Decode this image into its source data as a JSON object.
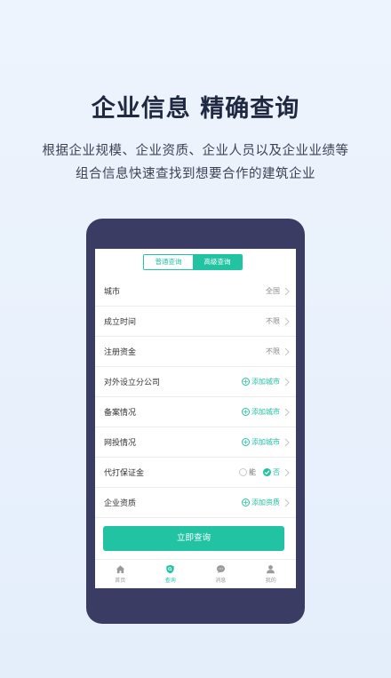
{
  "headline": "企业信息 精确查询",
  "subtitle_lines": [
    "根据企业规模、企业资质、企业人员以及企业业绩等",
    "组合信息快速查找到想要合作的建筑企业"
  ],
  "colors": {
    "accent": "#21c3a2",
    "phone_frame": "#3b3c64"
  },
  "segment": {
    "normal": "普通查询",
    "advanced": "高级查询",
    "active": "advanced"
  },
  "filters": [
    {
      "label": "城市",
      "value": "全国"
    },
    {
      "label": "成立时间",
      "value": "不限"
    },
    {
      "label": "注册资金",
      "value": "不限"
    },
    {
      "label": "对外设立分公司",
      "add": "添加城市"
    },
    {
      "label": "备案情况",
      "add": "添加城市"
    },
    {
      "label": "网投情况",
      "add": "添加城市"
    },
    {
      "label": "代打保证金",
      "options": [
        "能",
        "否"
      ],
      "selected": "否"
    },
    {
      "label": "企业资质",
      "add": "添加资质"
    }
  ],
  "query_button": "立即查询",
  "tabs": [
    {
      "label": "首页",
      "icon": "home-icon"
    },
    {
      "label": "查询",
      "icon": "search-shield-icon",
      "active": true
    },
    {
      "label": "消息",
      "icon": "message-icon"
    },
    {
      "label": "我的",
      "icon": "user-icon"
    }
  ]
}
